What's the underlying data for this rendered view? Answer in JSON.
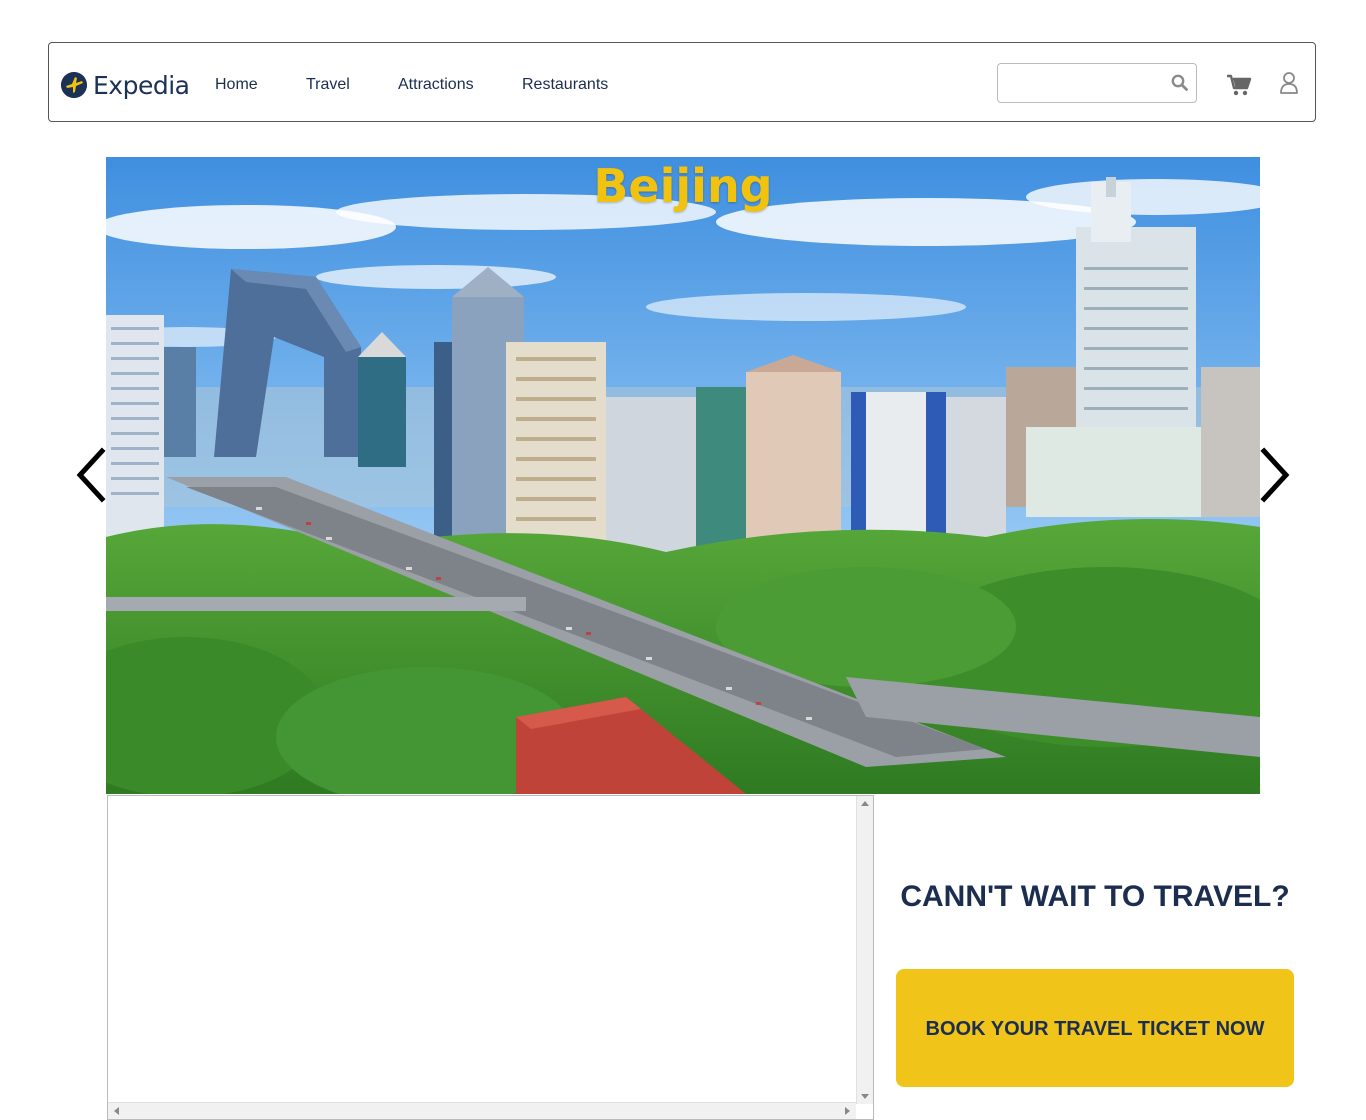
{
  "brand": {
    "name": "Expedia"
  },
  "nav": {
    "items": [
      {
        "label": "Home"
      },
      {
        "label": "Travel"
      },
      {
        "label": "Attractions"
      },
      {
        "label": "Restaurants"
      }
    ],
    "search": {
      "value": "",
      "placeholder": "",
      "icon": "search-icon"
    },
    "cart_icon": "cart-icon",
    "user_icon": "user-icon"
  },
  "hero": {
    "title": "Beijing",
    "prev_icon": "chevron-left-icon",
    "next_icon": "chevron-right-icon"
  },
  "cta": {
    "heading": "CANN'T WAIT TO TRAVEL?",
    "button_label": "BOOK YOUR TRAVEL TICKET NOW"
  },
  "colors": {
    "accent_yellow": "#f0c419",
    "navy": "#1b2e50"
  }
}
